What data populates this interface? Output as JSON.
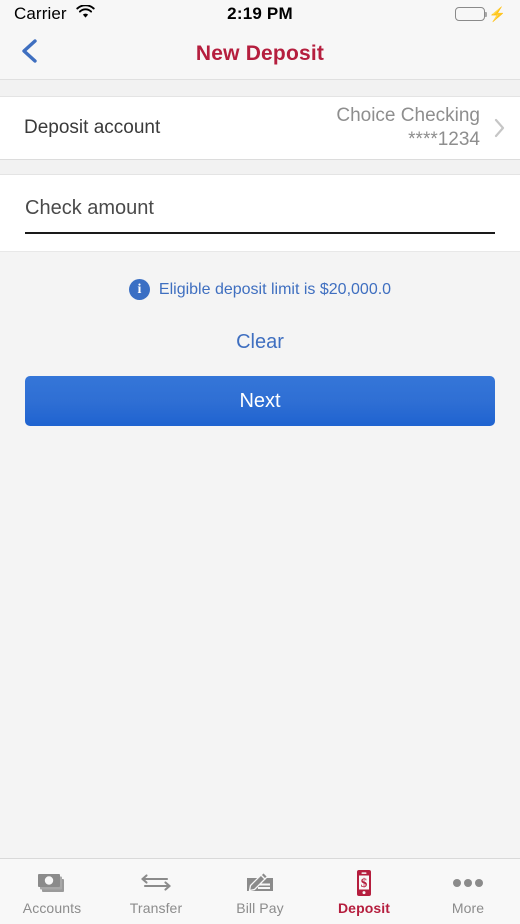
{
  "status_bar": {
    "carrier": "Carrier",
    "time": "2:19 PM",
    "wifi_icon": "wifi-icon",
    "battery_icon": "battery-full-icon",
    "charging_icon": "charging-bolt-icon"
  },
  "nav": {
    "title": "New Deposit",
    "back_icon": "chevron-left-icon",
    "back_color": "#3f6fc0",
    "title_color": "#b51e3e"
  },
  "account_row": {
    "label": "Deposit account",
    "account_name": "Choice Checking",
    "account_mask": "****1234",
    "disclosure_icon": "chevron-right-icon"
  },
  "amount_field": {
    "placeholder": "Check amount",
    "value": ""
  },
  "hint": {
    "icon": "info-icon",
    "text": "Eligible deposit limit is $20,000.0",
    "color": "#3f6fc0"
  },
  "actions": {
    "clear_label": "Clear",
    "next_label": "Next",
    "next_color": "#2f6fd4"
  },
  "tabbar": {
    "items": [
      {
        "label": "Accounts",
        "icon": "cash-stack-icon",
        "active": false
      },
      {
        "label": "Transfer",
        "icon": "transfer-arrows-icon",
        "active": false
      },
      {
        "label": "Bill Pay",
        "icon": "check-pencil-icon",
        "active": false
      },
      {
        "label": "Deposit",
        "icon": "phone-dollar-icon",
        "active": true
      },
      {
        "label": "More",
        "icon": "ellipsis-icon",
        "active": false
      }
    ],
    "active_color": "#b51e3e",
    "inactive_color": "#8c8c8c"
  }
}
